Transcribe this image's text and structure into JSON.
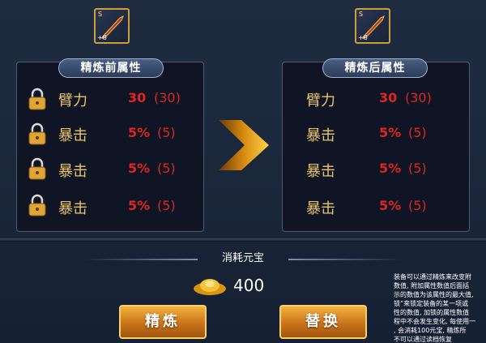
{
  "items": {
    "left": {
      "grade": "S",
      "plus": "+8"
    },
    "right": {
      "grade": "S",
      "plus": "+8"
    }
  },
  "before": {
    "title": "精炼前属性",
    "rows": [
      {
        "name": "臂力",
        "value": "30",
        "base": "(30)"
      },
      {
        "name": "暴击",
        "value": "5%",
        "base": "(5)"
      },
      {
        "name": "暴击",
        "value": "5%",
        "base": "(5)"
      },
      {
        "name": "暴击",
        "value": "5%",
        "base": "(5)"
      }
    ]
  },
  "after": {
    "title": "精炼后属性",
    "rows": [
      {
        "name": "臂力",
        "value": "30",
        "base": "(30)"
      },
      {
        "name": "暴击",
        "value": "5%",
        "base": "(5)"
      },
      {
        "name": "暴击",
        "value": "5%",
        "base": "(5)"
      },
      {
        "name": "暴击",
        "value": "5%",
        "base": "(5)"
      }
    ]
  },
  "cost": {
    "label": "消耗元宝",
    "amount": "400",
    "icon": "gold-ingot-icon"
  },
  "buttons": {
    "refine": "精炼",
    "replace": "替换"
  },
  "help_lines": [
    "装备可以通过精炼来改变附",
    "数值, 附加属性数值后面括",
    "示的数值为该属性的最大值,",
    "锁”来锁定装备的某一项或",
    "性的数值, 加锁的属性数值",
    "程中不会发生变化, 每使用一",
    ", 会消耗100元宝, 精炼所",
    "不可以通过读档恢复"
  ],
  "colors": {
    "accent": "#e8c46a",
    "value": "#e0241f",
    "button": "#e59a2c"
  }
}
